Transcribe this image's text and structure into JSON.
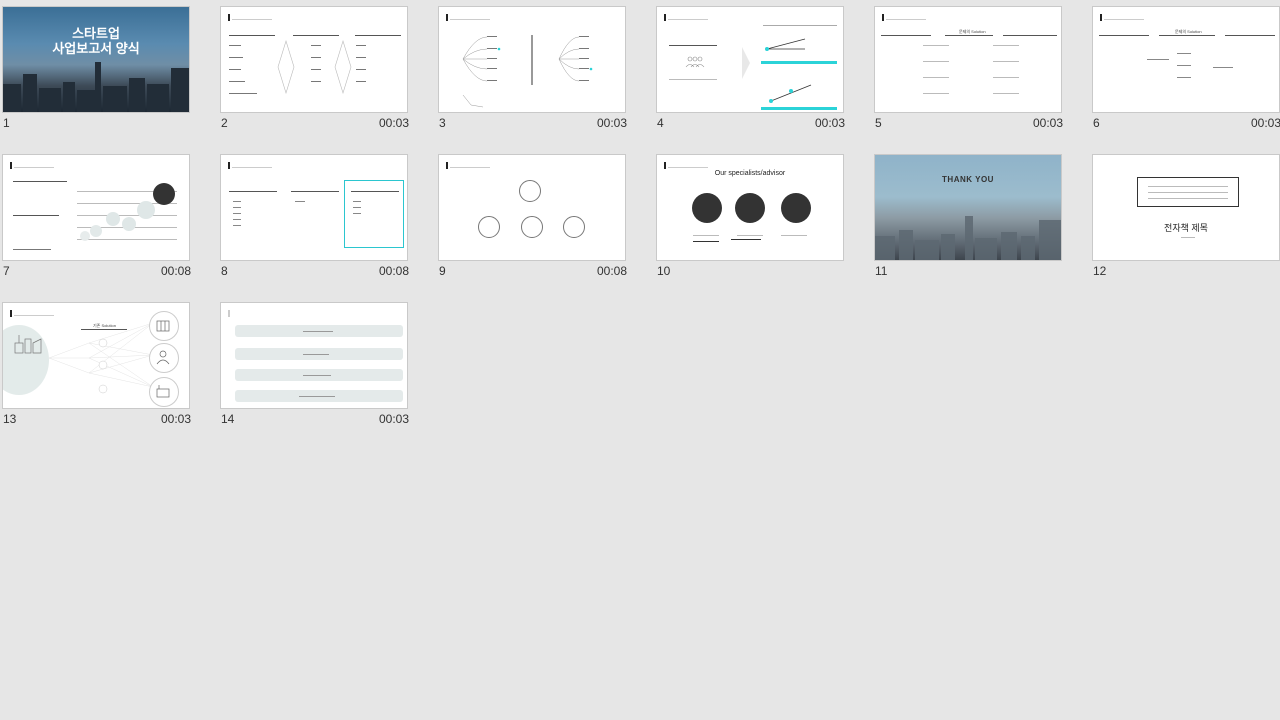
{
  "slides": [
    {
      "num": "1",
      "duration": "",
      "title_line1": "스타트업",
      "title_line2": "사업보고서 양식"
    },
    {
      "num": "2",
      "duration": "00:03"
    },
    {
      "num": "3",
      "duration": "00:03"
    },
    {
      "num": "4",
      "duration": "00:03"
    },
    {
      "num": "5",
      "duration": "00:03",
      "label": "문제의 Solution"
    },
    {
      "num": "6",
      "duration": "00:03",
      "label": "문제의 Solution"
    },
    {
      "num": "7",
      "duration": "00:08"
    },
    {
      "num": "8",
      "duration": "00:08"
    },
    {
      "num": "9",
      "duration": "00:08"
    },
    {
      "num": "10",
      "duration": "",
      "heading": "Our specialists/advisor"
    },
    {
      "num": "11",
      "duration": "",
      "heading": "THANK YOU"
    },
    {
      "num": "12",
      "duration": "",
      "heading": "전자책 제목"
    },
    {
      "num": "13",
      "duration": "00:03",
      "label": "기존 Solution"
    },
    {
      "num": "14",
      "duration": "00:03"
    }
  ]
}
